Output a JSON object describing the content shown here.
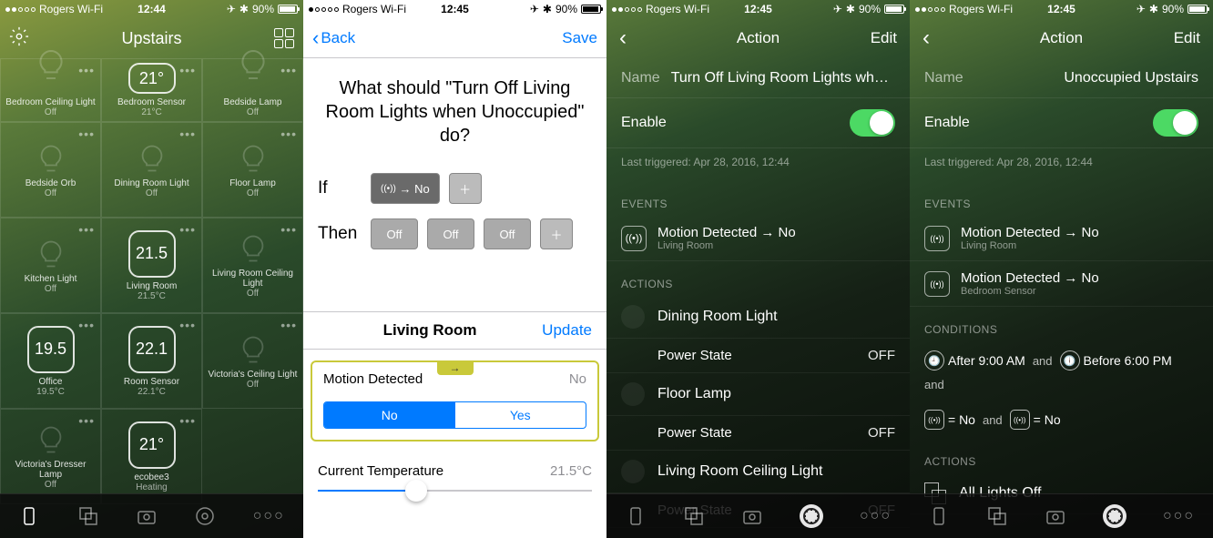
{
  "status": {
    "carrier": "Rogers Wi-Fi",
    "time": "12:44",
    "time2": "12:45",
    "battery": "90%"
  },
  "s1": {
    "title": "Upstairs",
    "tiles": [
      {
        "name": "Bedroom Ceiling Light",
        "sub": "Off",
        "type": "bulb"
      },
      {
        "name": "Bedroom Sensor",
        "sub": "21°C",
        "type": "sensor",
        "value": "21°"
      },
      {
        "name": "Bedside Lamp",
        "sub": "Off",
        "type": "bulb"
      },
      {
        "name": "Bedside Orb",
        "sub": "Off",
        "type": "bulb"
      },
      {
        "name": "Dining Room Light",
        "sub": "Off",
        "type": "bulb"
      },
      {
        "name": "Floor Lamp",
        "sub": "Off",
        "type": "bulb"
      },
      {
        "name": "Kitchen Light",
        "sub": "Off",
        "type": "bulb"
      },
      {
        "name": "Living Room",
        "sub": "21.5°C",
        "type": "sensor",
        "value": "21.5"
      },
      {
        "name": "Living Room Ceiling Light",
        "sub": "Off",
        "type": "bulb"
      },
      {
        "name": "Office",
        "sub": "19.5°C",
        "type": "sensor",
        "value": "19.5"
      },
      {
        "name": "Room Sensor",
        "sub": "22.1°C",
        "type": "sensor",
        "value": "22.1"
      },
      {
        "name": "Victoria's Ceiling Light",
        "sub": "Off",
        "type": "bulb"
      },
      {
        "name": "Victoria's Dresser Lamp",
        "sub": "Off",
        "type": "bulb"
      },
      {
        "name": "ecobee3",
        "sub": "Heating",
        "type": "sensor",
        "value": "21°"
      }
    ]
  },
  "s2": {
    "back": "Back",
    "save": "Save",
    "title": "What should \"Turn Off Living Room Lights when Unoccupied\" do?",
    "if": "If",
    "then": "Then",
    "no": "No",
    "off": "Off",
    "room": "Living Room",
    "update": "Update",
    "motion": "Motion Detected",
    "motion_val": "No",
    "seg_no": "No",
    "seg_yes": "Yes",
    "temp": "Current Temperature",
    "temp_val": "21.5°C"
  },
  "s3": {
    "title": "Action",
    "edit": "Edit",
    "name_label": "Name",
    "name": "Turn Off Living Room Lights when Unoccup…",
    "enable": "Enable",
    "last": "Last triggered: Apr 28, 2016, 12:44",
    "events_hdr": "EVENTS",
    "event": {
      "title": "Motion Detected → No",
      "sub": "Living Room"
    },
    "actions_hdr": "ACTIONS",
    "actions": [
      {
        "name": "Dining Room Light",
        "prop": "Power State",
        "val": "OFF"
      },
      {
        "name": "Floor Lamp",
        "prop": "Power State",
        "val": "OFF"
      },
      {
        "name": "Living Room Ceiling Light",
        "prop": "Power State",
        "val": "OFF"
      }
    ]
  },
  "s4": {
    "title": "Action",
    "edit": "Edit",
    "name_label": "Name",
    "name": "Unoccupied Upstairs",
    "enable": "Enable",
    "last": "Last triggered: Apr 28, 2016, 12:44",
    "events_hdr": "EVENTS",
    "events": [
      {
        "title": "Motion Detected → No",
        "sub": "Living Room"
      },
      {
        "title": "Motion Detected → No",
        "sub": "Bedroom Sensor"
      }
    ],
    "cond_hdr": "CONDITIONS",
    "cond": {
      "after": "After 9:00 AM",
      "before": "Before 6:00 PM",
      "eqno": "= No",
      "and": "and"
    },
    "actions_hdr": "ACTIONS",
    "scene": "All Lights Off"
  }
}
